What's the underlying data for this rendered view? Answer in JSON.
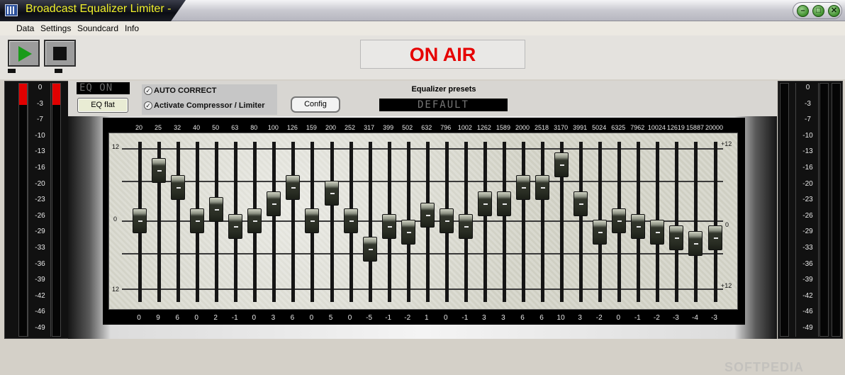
{
  "window": {
    "title": "Broadcast Equalizer Limiter -"
  },
  "window_buttons": [
    "minimize-button",
    "maximize-button",
    "close-button"
  ],
  "menu": [
    "Data",
    "Settings",
    "Soundcard",
    "Info"
  ],
  "transport": {
    "play_icon": "play-icon",
    "stop_icon": "stop-icon"
  },
  "onair": "ON AIR",
  "eq_status": "EQ ON",
  "eq_flat_label": "EQ flat",
  "auto_correct_label": "AUTO CORRECT",
  "compressor_label": "Activate Compressor / Limiter",
  "config_label": "Config",
  "presets_label": "Equalizer presets",
  "preset_name": "DEFAULT",
  "vu_scale": [
    "0",
    "-3",
    "-7",
    "-10",
    "-13",
    "-16",
    "-20",
    "-23",
    "-26",
    "-29",
    "-33",
    "-36",
    "-39",
    "-42",
    "-46",
    "-49"
  ],
  "eq_scale": {
    "top_left": "12",
    "mid_left": "0",
    "bot_left": "12",
    "top_right": "+12",
    "mid_right": "0",
    "bot_right": "+12"
  },
  "frequencies": [
    "20",
    "25",
    "32",
    "40",
    "50",
    "63",
    "80",
    "100",
    "126",
    "159",
    "200",
    "252",
    "317",
    "399",
    "502",
    "632",
    "796",
    "1002",
    "1262",
    "1589",
    "2000",
    "2518",
    "3170",
    "3991",
    "5024",
    "6325",
    "7962",
    "10024",
    "12619",
    "15887",
    "20000"
  ],
  "band_values": [
    "0",
    "9",
    "6",
    "0",
    "2",
    "-1",
    "0",
    "3",
    "6",
    "0",
    "5",
    "0",
    "-5",
    "-1",
    "-2",
    "1",
    "0",
    "-1",
    "3",
    "3",
    "6",
    "6",
    "10",
    "3",
    "-2",
    "0",
    "-1",
    "-2",
    "-3",
    "-4",
    "-3"
  ],
  "watermark": "SOFTPEDIA"
}
